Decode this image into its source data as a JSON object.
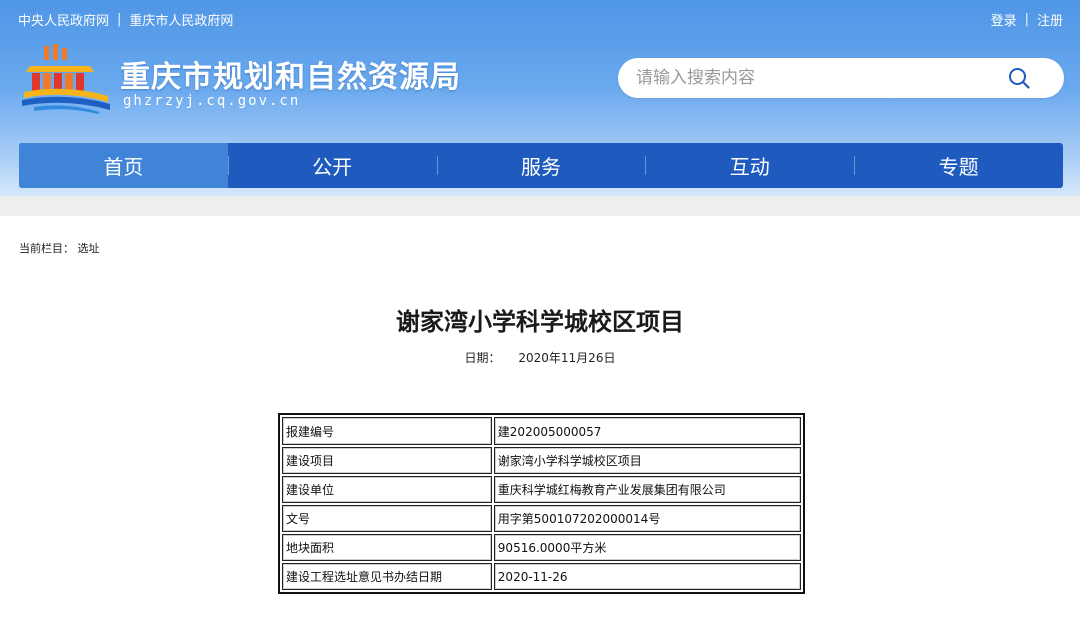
{
  "topbar": {
    "link_central": "中央人民政府网",
    "separator": "|",
    "link_city": "重庆市人民政府网",
    "login": "登录",
    "register": "注册"
  },
  "site": {
    "title": "重庆市规划和自然资源局",
    "domain": "ghzrzyj.cq.gov.cn"
  },
  "search": {
    "placeholder": "请输入搜索内容",
    "icon": "search-icon"
  },
  "nav": {
    "items": [
      {
        "label": "首页",
        "active": true
      },
      {
        "label": "公开",
        "active": false
      },
      {
        "label": "服务",
        "active": false
      },
      {
        "label": "互动",
        "active": false
      },
      {
        "label": "专题",
        "active": false
      }
    ]
  },
  "breadcrumb": {
    "label": "当前栏目：",
    "current": "选址"
  },
  "article": {
    "title": "谢家湾小学科学城校区项目",
    "date_label": "日期：",
    "date_value": "2020年11月26日"
  },
  "table": {
    "rows": [
      {
        "label": "报建编号",
        "value": "建202005000057"
      },
      {
        "label": "建设项目",
        "value": "谢家湾小学科学城校区项目"
      },
      {
        "label": "建设单位",
        "value": "重庆科学城红梅教育产业发展集团有限公司"
      },
      {
        "label": "文号",
        "value": "用字第500107202000014号"
      },
      {
        "label": "地块面积",
        "value": "90516.0000平方米"
      },
      {
        "label": "建设工程选址意见书办结日期",
        "value": "2020-11-26"
      }
    ]
  },
  "colors": {
    "header_gradient_top": "#4f96e6",
    "nav_background": "#1f5bbf",
    "nav_active": "#3f84d6",
    "logo_orange": "#f07a2a",
    "logo_red": "#e0372d",
    "logo_blue": "#1e5fc4",
    "logo_yellow": "#f4b41a"
  }
}
